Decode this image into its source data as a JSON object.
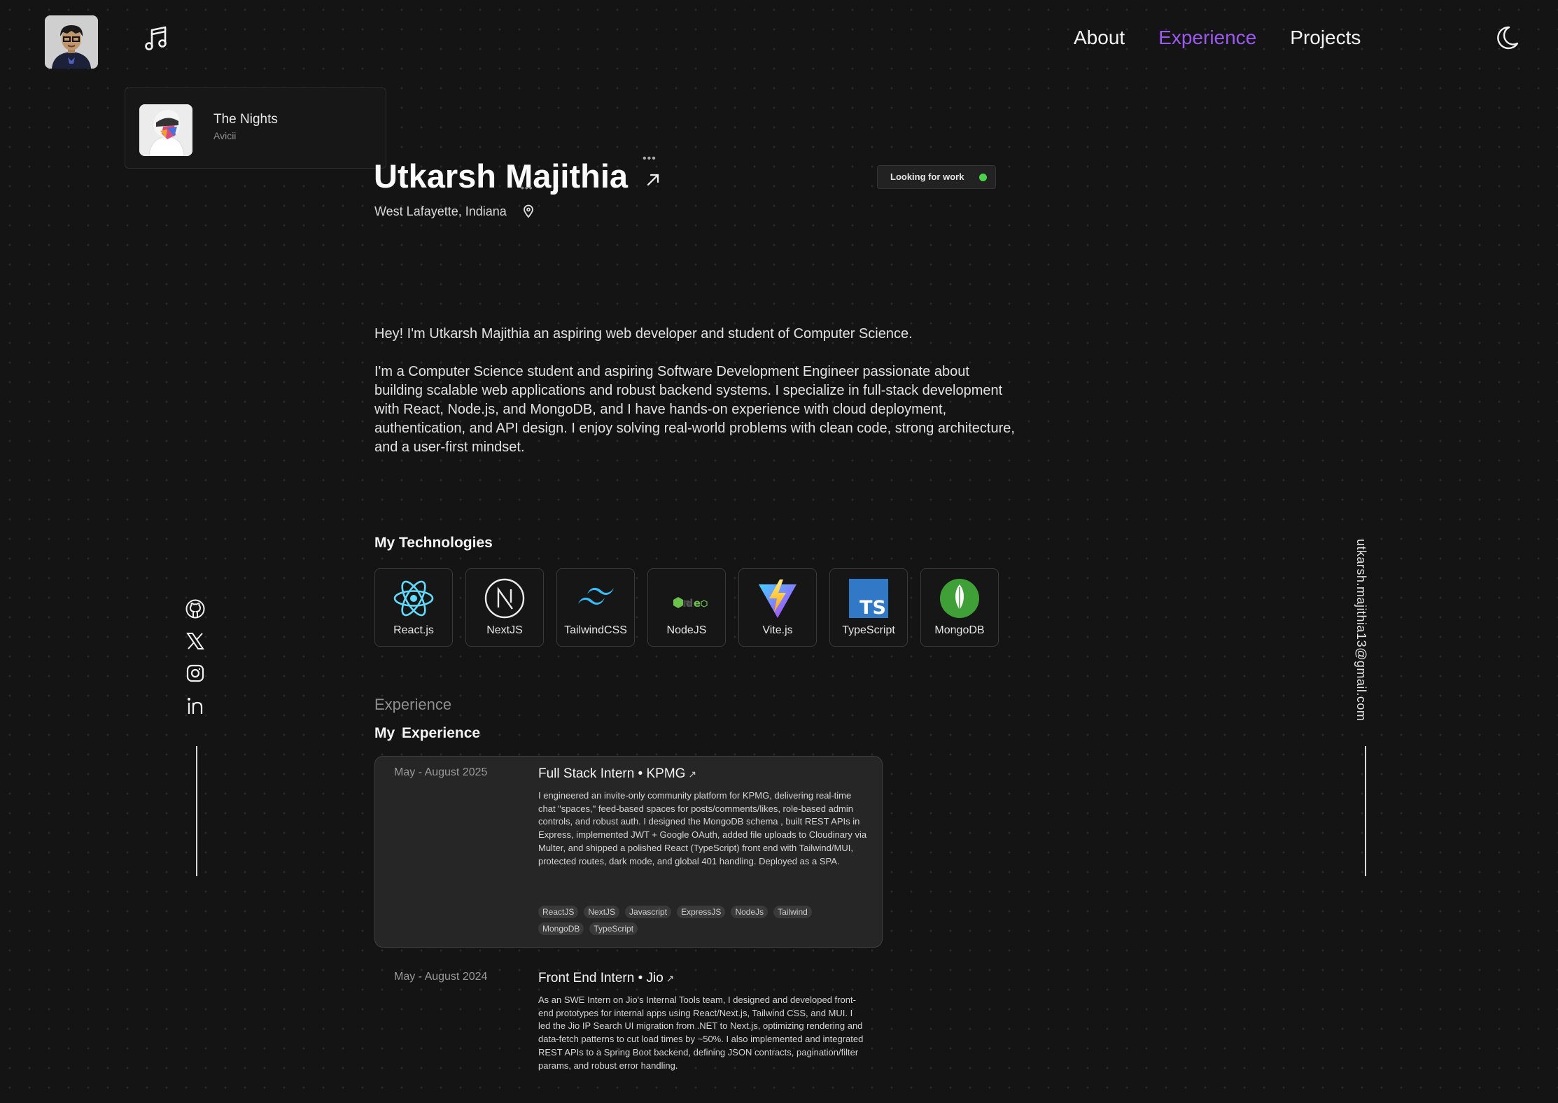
{
  "header": {
    "nav": [
      "About",
      "Experience",
      "Projects"
    ],
    "active_nav": "Experience"
  },
  "now_playing": {
    "title": "The Nights",
    "artist": "Avicii"
  },
  "hero": {
    "name": "Utkarsh Majithia",
    "location": "West Lafayette, Indiana",
    "status": "Looking for work",
    "intro": "Hey! I'm Utkarsh Majithia an aspiring web developer and student of Computer Science.",
    "about": "I'm a Computer Science student and aspiring Software Development Engineer passionate about building scalable web applications and robust backend systems. I specialize in full-stack development with React, Node.js, and MongoDB, and I have hands-on experience with cloud deployment, authentication, and API design. I enjoy solving real-world problems with clean code, strong architecture, and a user-first mindset."
  },
  "technologies": {
    "heading": "My Technologies",
    "items": [
      "React.js",
      "NextJS",
      "TailwindCSS",
      "NodeJS",
      "Vite.js",
      "TypeScript",
      "MongoDB"
    ]
  },
  "social": {
    "email": "utkarsh.majithia13@gmail.com"
  },
  "experience": {
    "kicker": "Experience",
    "heading": "My  Experience",
    "items": [
      {
        "date": "May - August 2025",
        "title": "Full Stack Intern • KPMG",
        "description": "I engineered an invite-only community platform for KPMG, delivering real-time chat \"spaces,\" feed-based spaces for posts/comments/likes, role-based admin controls, and robust auth. I designed the MongoDB schema , built REST APIs in Express, implemented JWT + Google OAuth, added file uploads to Cloudinary via Multer, and shipped a polished React (TypeScript) front end with Tailwind/MUI, protected routes, dark mode, and global 401 handling. Deployed as a SPA.",
        "tags": [
          "ReactJS",
          "NextJS",
          "Javascript",
          "ExpressJS",
          "NodeJs",
          "Tailwind",
          "MongoDB",
          "TypeScript"
        ]
      },
      {
        "date": "May - August 2024",
        "title": "Front End Intern • Jio",
        "description": "As an SWE Intern on Jio's Internal Tools team, I designed and developed front-end prototypes for internal apps using React/Next.js, Tailwind CSS, and MUI. I led the Jio IP Search UI migration from .NET to Next.js, optimizing rendering and data-fetch patterns to cut load times by ~50%. I also implemented and integrated REST APIs to a Spring Boot backend, defining JSON contracts, pagination/filter params, and robust error handling."
      }
    ]
  },
  "colors": {
    "accent": "#9b59f0",
    "status_dot": "#4cd14c",
    "background": "#141414"
  },
  "icons": [
    "music-note-icon",
    "moon-icon",
    "external-link-icon",
    "map-pin-icon",
    "github-icon",
    "x-icon",
    "instagram-icon",
    "linkedin-icon"
  ]
}
